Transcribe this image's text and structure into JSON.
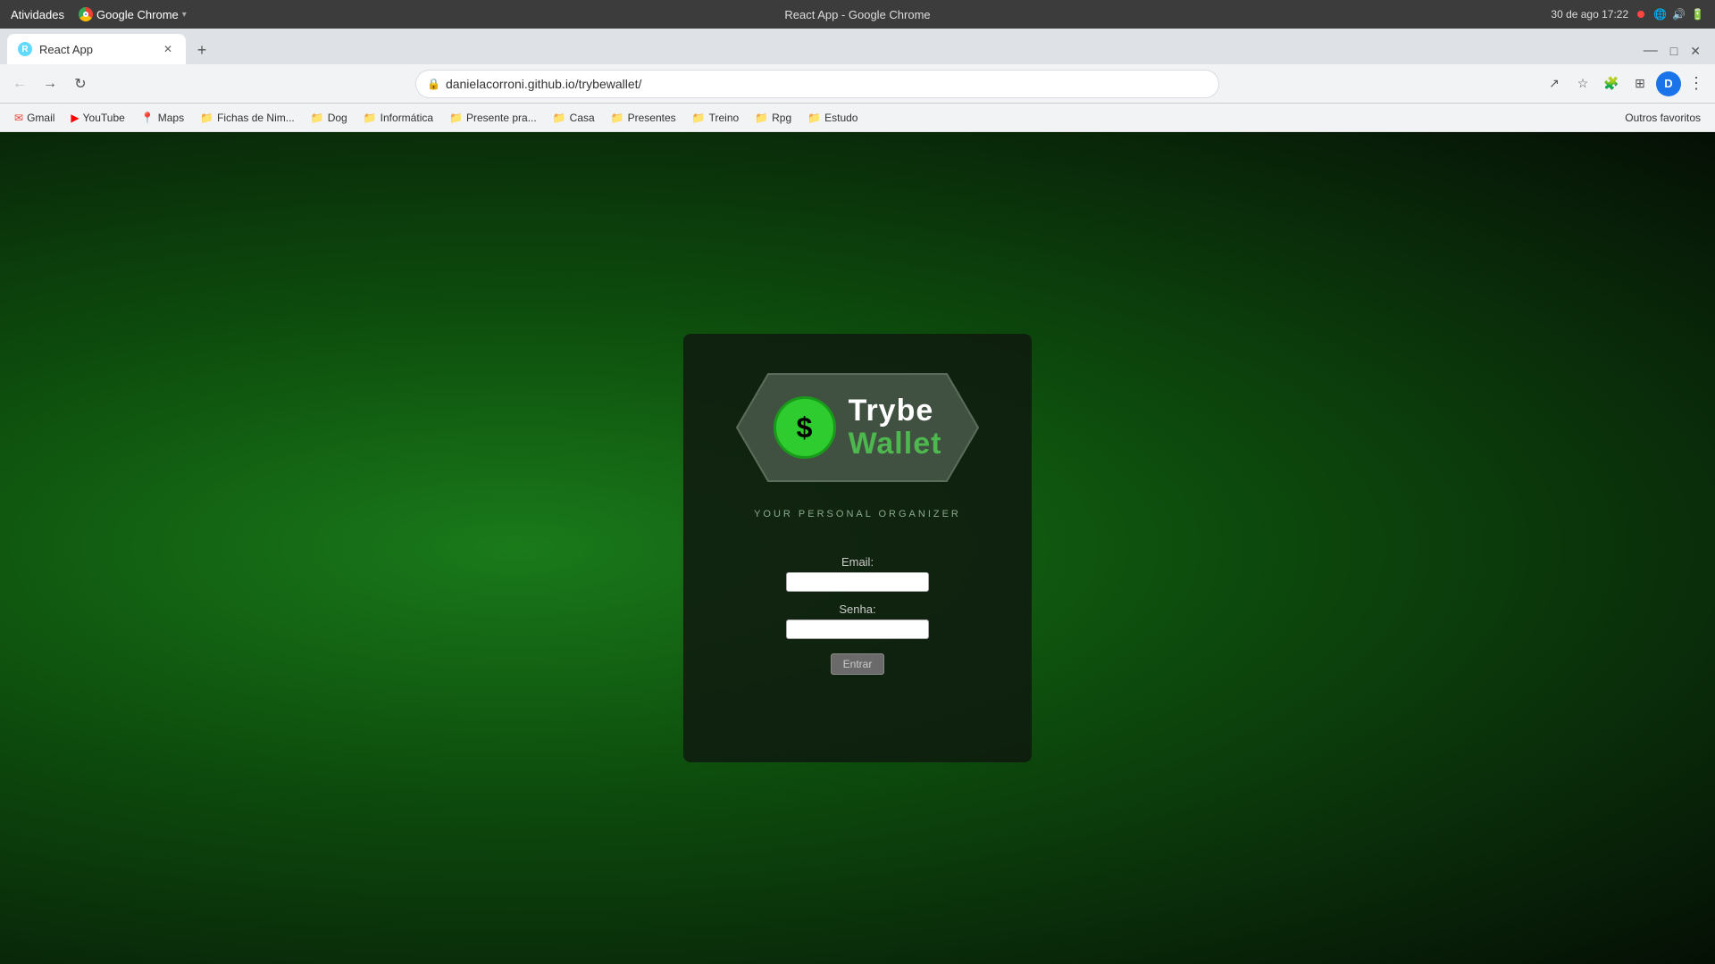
{
  "os": {
    "titlebar": {
      "left": "Atividades",
      "center": "React App - Google Chrome",
      "app": "Google Chrome",
      "datetime": "30 de ago  17:22"
    }
  },
  "browser": {
    "tab": {
      "title": "React App",
      "favicon_letter": "R"
    },
    "new_tab_label": "+",
    "address_bar": {
      "url": "danielacorroni.github.io/trybewallet/",
      "lock_icon": "🔒"
    },
    "bookmarks": [
      {
        "label": "Gmail",
        "icon": "✉"
      },
      {
        "label": "YouTube",
        "icon": "▶"
      },
      {
        "label": "Maps",
        "icon": "📍"
      },
      {
        "label": "Fichas de Nim...",
        "icon": "📁"
      },
      {
        "label": "Dog",
        "icon": "📁"
      },
      {
        "label": "Informática",
        "icon": "📁"
      },
      {
        "label": "Presente pra...",
        "icon": "📁"
      },
      {
        "label": "Casa",
        "icon": "📁"
      },
      {
        "label": "Presentes",
        "icon": "📁"
      },
      {
        "label": "Treino",
        "icon": "📁"
      },
      {
        "label": "Rpg",
        "icon": "📁"
      },
      {
        "label": "Estudo",
        "icon": "📁"
      }
    ],
    "bookmarks_other": "Outros favoritos"
  },
  "app": {
    "logo": {
      "brand_name_1": "Trybe",
      "brand_name_2": "Wallet",
      "tagline": "YOUR PERSONAL ORGANIZER",
      "dollar_symbol": "$"
    },
    "form": {
      "email_label": "Email:",
      "password_label": "Senha:",
      "submit_label": "Entrar",
      "email_value": "",
      "password_value": ""
    }
  }
}
